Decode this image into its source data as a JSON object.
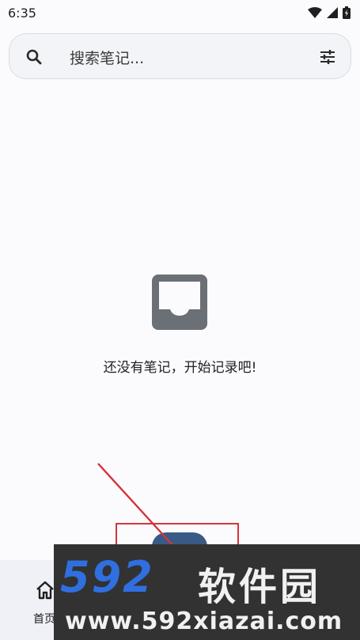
{
  "status_bar": {
    "time": "6:35",
    "icons": [
      "wifi-icon",
      "signal-icon",
      "battery-icon"
    ]
  },
  "search": {
    "placeholder": "搜索笔记...",
    "icon": "search-icon",
    "filter_icon": "tune-icon"
  },
  "empty_state": {
    "icon": "inbox-icon",
    "message": "还没有笔记，开始记录吧!"
  },
  "bottom_nav": {
    "items": [
      {
        "label": "首页",
        "icon": "home-icon"
      }
    ]
  },
  "watermark": {
    "logo_number": "592",
    "brand": "软件园",
    "url": "www.592xiazai.com"
  },
  "colors": {
    "accent": "#3a5a86",
    "annotation": "#d6343c",
    "icon_gray": "#6b6f76"
  }
}
